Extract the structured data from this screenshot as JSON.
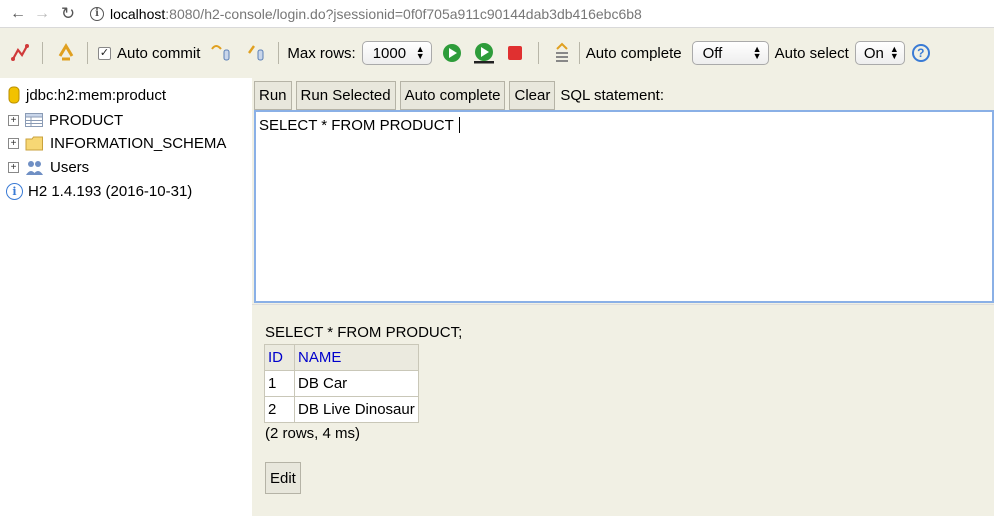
{
  "browser": {
    "url_host": "localhost",
    "url_rest": ":8080/h2-console/login.do?jsessionid=0f0f705a911c90144dab3db416ebc6b8"
  },
  "toolbar": {
    "auto_commit_label": "Auto commit",
    "auto_commit_checked": true,
    "max_rows_label": "Max rows:",
    "max_rows_value": "1000",
    "auto_complete_label": "Auto complete",
    "auto_complete_value": "Off",
    "auto_select_label": "Auto select",
    "auto_select_value": "On",
    "help_symbol": "?"
  },
  "tree": {
    "connection": "jdbc:h2:mem:product",
    "items": [
      {
        "label": "PRODUCT",
        "icon": "table-icon"
      },
      {
        "label": "INFORMATION_SCHEMA",
        "icon": "folder-icon"
      },
      {
        "label": "Users",
        "icon": "users-icon"
      }
    ],
    "version": "H2 1.4.193 (2016-10-31)"
  },
  "query": {
    "buttons": {
      "run": "Run",
      "run_selected": "Run Selected",
      "auto_complete": "Auto complete",
      "clear": "Clear"
    },
    "sql_label": "SQL statement:",
    "sql_text": "SELECT * FROM PRODUCT"
  },
  "result": {
    "sql": "SELECT * FROM PRODUCT;",
    "columns": [
      "ID",
      "NAME"
    ],
    "rows": [
      [
        "1",
        "DB Car"
      ],
      [
        "2",
        "DB Live Dinosaur"
      ]
    ],
    "info": "(2 rows, 4 ms)",
    "edit_label": "Edit"
  },
  "colors": {
    "panel_bg": "#f1f0e4",
    "header_link": "#0000cc",
    "focus_border": "#8ab0e6"
  }
}
